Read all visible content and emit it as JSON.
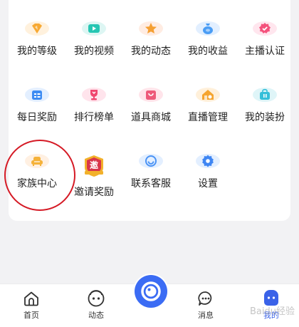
{
  "grid": {
    "items": [
      {
        "label": "我的等级",
        "icon": "level-icon",
        "bg": "#fff1dd",
        "color": "#f7a933"
      },
      {
        "label": "我的视频",
        "icon": "video-icon",
        "bg": "#ddf6f3",
        "color": "#26c6b3"
      },
      {
        "label": "我的动态",
        "icon": "star-icon",
        "bg": "#ffece2",
        "color": "#f5a033"
      },
      {
        "label": "我的收益",
        "icon": "money-bag-icon",
        "bg": "#e2efff",
        "color": "#4a9df5"
      },
      {
        "label": "主播认证",
        "icon": "badge-icon",
        "bg": "#ffe6ee",
        "color": "#f4527c"
      },
      {
        "label": "每日奖励",
        "icon": "calendar-icon",
        "bg": "#e3efff",
        "color": "#3d8cf3"
      },
      {
        "label": "排行榜单",
        "icon": "trophy-icon",
        "bg": "#ffe4ec",
        "color": "#f0466f"
      },
      {
        "label": "道具商城",
        "icon": "shop-icon",
        "bg": "#ffe4ea",
        "color": "#ee5a7a"
      },
      {
        "label": "直播管理",
        "icon": "house-icon",
        "bg": "#fff0da",
        "color": "#f5a530"
      },
      {
        "label": "我的装扮",
        "icon": "bag-icon",
        "bg": "#dff5f8",
        "color": "#36bfd9"
      },
      {
        "label": "家族中心",
        "icon": "sofa-icon",
        "bg": "#fff0e2",
        "color": "#f5b23a"
      },
      {
        "label": "邀请奖励",
        "icon": "invite-reward-icon",
        "badge_text": "邀",
        "bg": "#ffffff",
        "color": "#f2b12b"
      },
      {
        "label": "联系客服",
        "icon": "customer-service-icon",
        "bg": "#e3efff",
        "color": "#4a93f5"
      },
      {
        "label": "设置",
        "icon": "settings-gear-icon",
        "bg": "#e3efff",
        "color": "#3f86f3"
      }
    ]
  },
  "tabbar": {
    "home": "首页",
    "feed": "动态",
    "messages": "消息",
    "mine": "我的",
    "active_color": "#3a62e8"
  },
  "watermark": "Baidu经验"
}
